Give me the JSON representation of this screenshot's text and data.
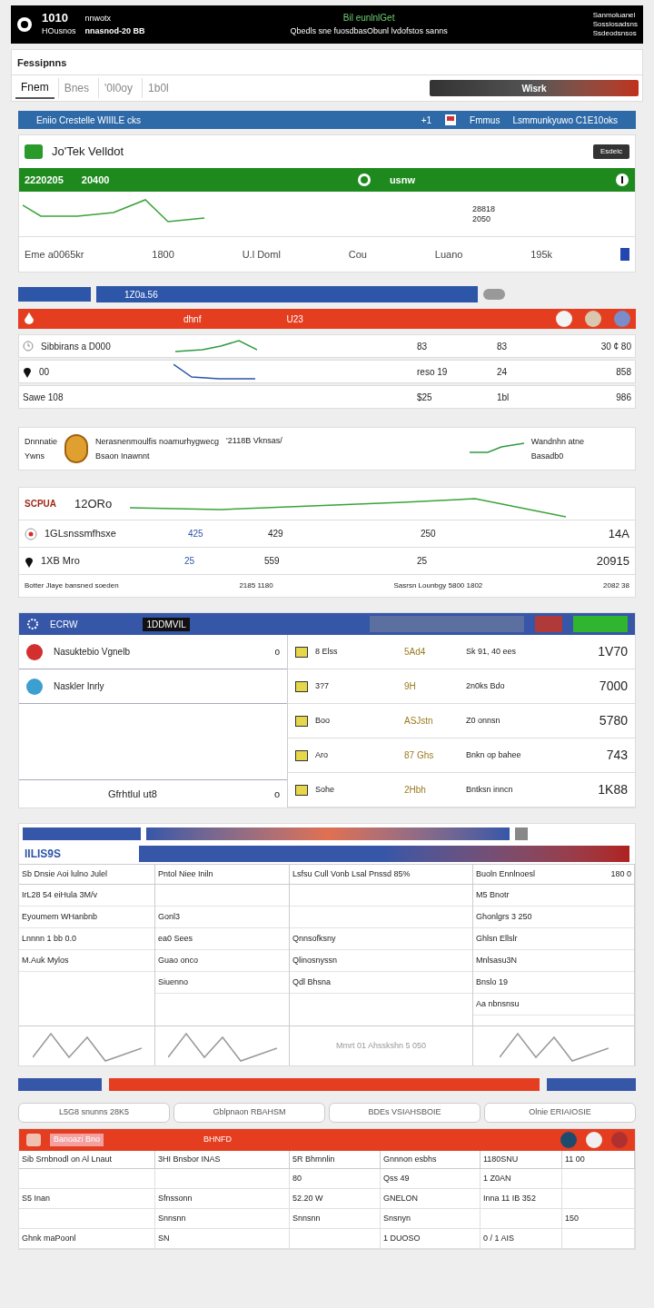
{
  "header": {
    "logo_text": "1010",
    "subtitle": "HOusnos",
    "left_text": "nnwotx",
    "left_value": "nnasnod-20 BB",
    "center_title": "Bil eunlnlGet",
    "center_text": "Qbedls sne fuosdbasObunl lvdofstos sanns",
    "right_lines": [
      "Sanmoluanel",
      "Sosslosadsns",
      "Ssdeodsnsos"
    ]
  },
  "title_card": {
    "title": "Fessipnns",
    "button": "Wisrk",
    "tabs": [
      {
        "label": "Fnem",
        "selected": true
      },
      {
        "label": "Bnes",
        "selected": false
      },
      {
        "label": "'0l0oy",
        "selected": false
      },
      {
        "label": "1b0l",
        "selected": false
      }
    ]
  },
  "info_bar": {
    "left": "Eniio Crestelle WIIILE cks",
    "count": "+1",
    "middle": "Fmmus",
    "right": "Lsmmunkyuwo C1E10oks"
  },
  "summary_card": {
    "title": "Jo'Tek Velldot",
    "action": "Esdeic",
    "band_value_1": "2220205",
    "band_value_2": "20400",
    "band_label": "usnw",
    "chart_labels": [
      "28818",
      "2050"
    ],
    "footer": [
      "Eme a0065kr",
      "1800",
      "U.l Doml",
      "Cou",
      "Luano",
      "195k"
    ]
  },
  "search": {
    "value": "1Z0a.56"
  },
  "red_bar": {
    "label": "dhnf",
    "code": "U23"
  },
  "ticker_rows": [
    {
      "kind": "clock",
      "cells": [
        "Sibbirans a D000",
        "83",
        "83",
        "30 ¢ 80"
      ]
    },
    {
      "kind": "pin",
      "cells": [
        "00",
        "reso 19",
        "24",
        "858"
      ]
    },
    {
      "kind": "plain",
      "cells": [
        "Sawe 108",
        "$25",
        "1bl",
        "986"
      ]
    }
  ],
  "profile_card": {
    "label_1": "Dnnnatie",
    "label_2": "Ywns",
    "line_1": "Nerasnenmoulfis noamurhygwecg",
    "line_2": "Bsaon Inawnnt",
    "stamp": "'2118B Vknsas/",
    "trend_label": "Wandnhn atne",
    "trend_sub": "Basadb0"
  },
  "market_card": {
    "brand": "SCPUA",
    "price": "12ORo",
    "rows": [
      {
        "kind": "radio",
        "cells": [
          "1GLsnssmfhsxe",
          "425",
          "429",
          "250",
          "14A"
        ]
      },
      {
        "kind": "pin",
        "cells": [
          "1XB Mro",
          "25",
          "559",
          "25",
          "20915"
        ]
      }
    ],
    "footer": [
      "Botter Jlaye bansned soeden",
      "2185 1180",
      "Sasrsn Lounbgy 5800 1802",
      "2082 38"
    ]
  },
  "orders_card": {
    "header_title": "ECRW",
    "header_label": "1DDMVIL",
    "list": [
      {
        "title": "Nasuktebio Vgnelb",
        "count": "o",
        "color": "#d32f2f"
      },
      {
        "title": "Naskler Inrly",
        "color": "#3b9fd0"
      }
    ],
    "list_footer": "Gfrhtlul ut8",
    "list_footer_count": "o",
    "rows": [
      {
        "name": "8 Elss",
        "code": "5Ad4",
        "detail": "Sk 91, 40 ees",
        "value": "1V70"
      },
      {
        "name": "3?7",
        "code": "9H",
        "detail": "2n0ks Bdo",
        "value": "7000"
      },
      {
        "name": "Boo",
        "code": "ASJstn",
        "detail": "Z0 onnsn",
        "value": "5780"
      },
      {
        "name": "Aro",
        "code": "87 Ghs",
        "detail": "Bnkn op bahee",
        "value": "743"
      },
      {
        "name": "Sohe",
        "code": "2Hbh",
        "detail": "Bntksn inncn",
        "value": "1K88"
      }
    ]
  },
  "grid_card": {
    "brand": "IILIS9S",
    "columns": [
      {
        "heading": "Sb Dnsie Aoi lulno Julel",
        "cells": [
          "IrL28 54 eiHula 3M/v",
          "Eyoumem WHanbnb",
          "Lnnnn 1 bb 0.0",
          "M.Auk Mylos"
        ]
      },
      {
        "heading": "Pntol Niee Iniln",
        "cells": [
          "",
          "Gonl3",
          "ea0 Sees",
          "Guao onco",
          "Siuenno"
        ]
      },
      {
        "heading": "Lsfsu Cull Vonb Lsal Pnssd 85%",
        "cells": [
          "",
          "",
          "Qnnsofksny",
          "Qlinosnyssn",
          "Qdl Bhsna"
        ]
      },
      {
        "heading": "Buoln Ennlnoesl",
        "cells": [
          "M5 Bnotr",
          "Ghonlgrs 3 250",
          "Ghlsn Ellslr",
          "Mnlsasu3N",
          "Bnslo 19",
          "Aa nbnsnsu"
        ]
      }
    ],
    "footer_text": "Mmrt 01 Ahsskshn 5 050",
    "footer_value": "180 0"
  },
  "filters": [
    "L5G8 snunns 28K5",
    "Gblpnaon RBAHSM",
    "BDEs VSIAHSBOIE",
    "Olnie ERIAIOSIE"
  ],
  "bottom_table": {
    "toolbar_label": "Banoazi Bno",
    "toolbar_code": "BHNFD",
    "columns": [
      "Sib Srnbnodl on Al Lnaut",
      "3HI Bnsbor INAS",
      "5R Bhmnlin",
      "Gnnnon esbhs",
      "1180SNU",
      "11 00"
    ],
    "rows": [
      [
        "",
        "",
        "80",
        "Qss 49",
        "1 Z0AN",
        ""
      ],
      [
        "S5 Inan",
        "Sfnssonn",
        "52.20 W",
        "GNELON",
        "Inna 11 IB 352",
        ""
      ],
      [
        "",
        "Snnsnn",
        "Snnsnn",
        "Snsnyn",
        "",
        "150"
      ],
      [
        "Ghnk maPoonl",
        "SN",
        "",
        "1 DUOSO",
        "0 / 1 AIS",
        ""
      ]
    ]
  }
}
